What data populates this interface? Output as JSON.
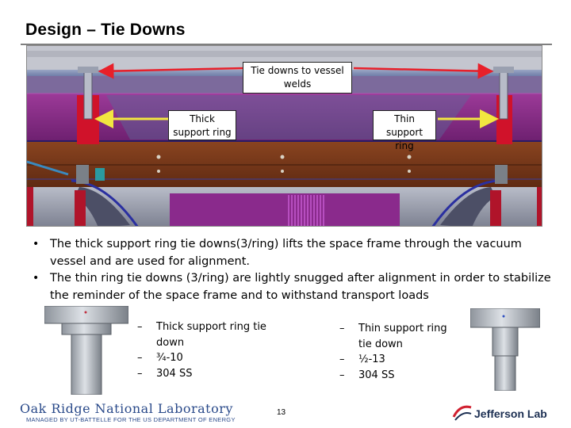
{
  "slide": {
    "title": "Design – Tie Downs",
    "page_number": "13"
  },
  "diagram": {
    "callout_welds": "Tie downs to vessel welds",
    "callout_thick": "Thick support ring",
    "callout_thin": "Thin support ring",
    "colors": {
      "arrow_red": "#e8202a",
      "arrow_yellow": "#f2e640",
      "vessel_brown": "#7a3b1c",
      "ring_magenta": "#8c2a8a",
      "tie_down_red": "#d0122a"
    }
  },
  "bullets": [
    {
      "marker": "•",
      "text": "The thick support ring tie downs(3/ring) lifts the space frame through the vacuum vessel and are used for alignment."
    },
    {
      "marker": "•",
      "text": "The thin ring tie downs (3/ring) are lightly snugged after alignment in order to stabilize the reminder of the space frame and to withstand transport loads"
    }
  ],
  "specs_left": {
    "marker": "–",
    "items": [
      "Thick support ring tie down",
      "¾-10",
      "304 SS"
    ]
  },
  "specs_right": {
    "marker": "–",
    "items": [
      "Thin support ring tie down",
      "½-13",
      "304 SS"
    ]
  },
  "logos": {
    "ornl_name": "Oak Ridge National Laboratory",
    "ornl_tagline": "MANAGED BY UT-BATTELLE FOR THE US DEPARTMENT OF ENERGY",
    "jlab_name": "Jefferson Lab"
  }
}
